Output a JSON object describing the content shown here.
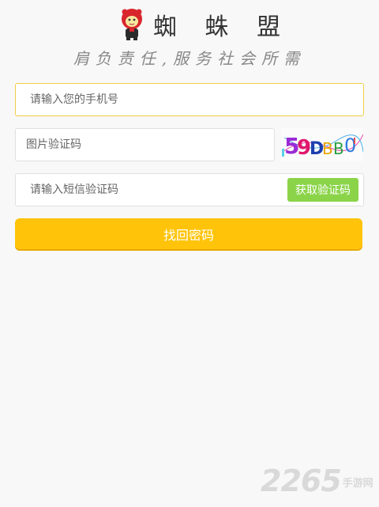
{
  "header": {
    "brand": "蜘 蛛 盟",
    "slogan": "肩负责任,服务社会所需"
  },
  "form": {
    "phone_placeholder": "请输入您的手机号",
    "image_code_placeholder": "图片验证码",
    "captcha_text": "59DBB0",
    "sms_code_placeholder": "请输入短信验证码",
    "sms_button_label": "获取验证码",
    "submit_label": "找回密码"
  },
  "watermark": {
    "number": "2265",
    "text": "手游网"
  },
  "colors": {
    "accent": "#ffc40a",
    "sms_button": "#8bd44a",
    "focus_border": "#f1cd4a"
  },
  "icons": {
    "mascot": "spider-mascot-icon"
  }
}
